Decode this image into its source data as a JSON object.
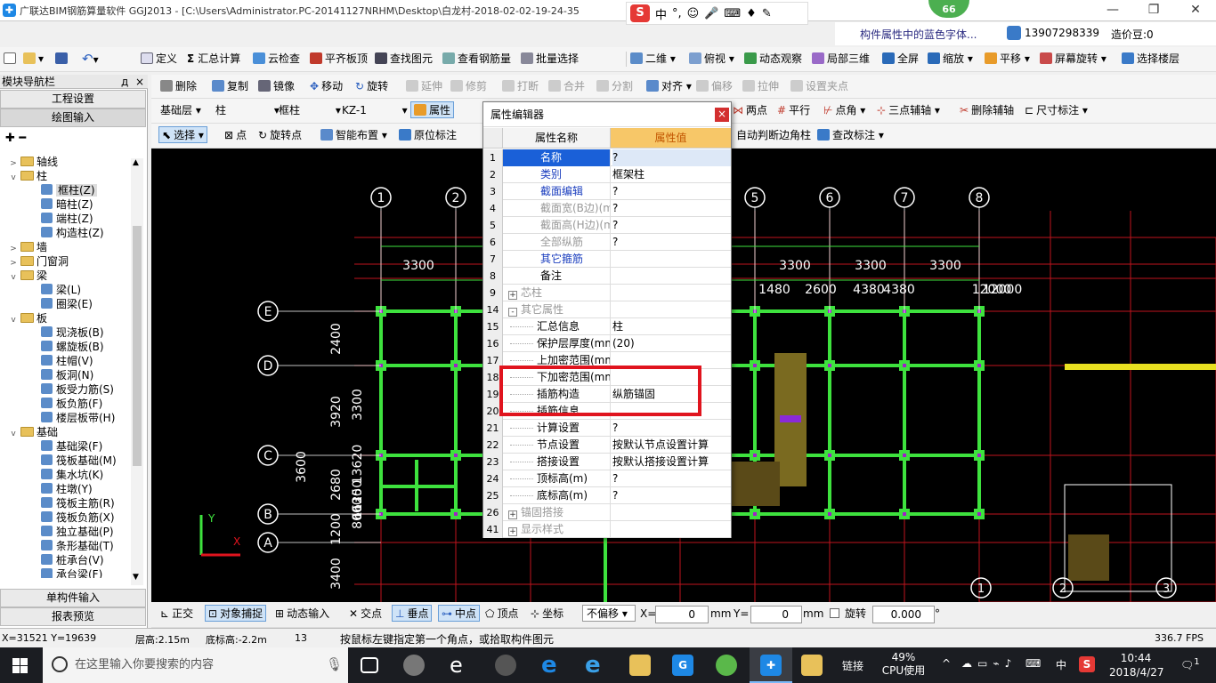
{
  "title_bar": {
    "title": "广联达BIM钢筋算量软件 GGJ2013 - [C:\\Users\\Administrator.PC-20141127NRHM\\Desktop\\白龙村-2018-02-02-19-24-35",
    "minimize": "—",
    "maximize": "❐",
    "close": "✕"
  },
  "ime": {
    "logo": "S",
    "lang": "中",
    "punct": "°,"
  },
  "badge": {
    "value": "66"
  },
  "info": {
    "hint": "构件属性中的蓝色字体...",
    "phone": "13907298339",
    "beans": "造价豆:0"
  },
  "toolbar1": {
    "items": [
      "定义",
      "汇总计算",
      "云检查",
      "平齐板顶",
      "查找图元",
      "查看钢筋量",
      "批量选择",
      "二维",
      "俯视",
      "动态观察",
      "局部三维",
      "全屏",
      "缩放",
      "平移",
      "屏幕旋转",
      "选择楼层"
    ]
  },
  "toolbar2": {
    "items": [
      "删除",
      "复制",
      "镜像",
      "移动",
      "旋转",
      "延伸",
      "修剪",
      "打断",
      "合并",
      "分割",
      "对齐",
      "偏移",
      "拉伸",
      "设置夹点"
    ]
  },
  "toolbar3": {
    "floor": "基础层",
    "type": "柱",
    "subtype": "框柱",
    "element": "KZ-1",
    "attr_btn": "属性",
    "right_items": [
      "两点",
      "平行",
      "点角",
      "三点辅轴",
      "删除辅轴",
      "尺寸标注"
    ]
  },
  "toolbar4": {
    "items": [
      "选择",
      "点",
      "旋转点",
      "智能布置",
      "原位标注"
    ],
    "right_items": [
      "自动判断边角柱",
      "查改标注"
    ]
  },
  "nav": {
    "header": "模块导航栏",
    "pin": "д",
    "close": "×",
    "top_buttons": [
      "工程设置",
      "绘图输入"
    ],
    "tree": [
      {
        "t": "轴线",
        "lvl": 0,
        "kind": "folder",
        "exp": ">"
      },
      {
        "t": "柱",
        "lvl": 0,
        "kind": "folder",
        "exp": "v"
      },
      {
        "t": "框柱(Z)",
        "lvl": 1,
        "kind": "leaf",
        "sel": true
      },
      {
        "t": "暗柱(Z)",
        "lvl": 1,
        "kind": "leaf"
      },
      {
        "t": "端柱(Z)",
        "lvl": 1,
        "kind": "leaf"
      },
      {
        "t": "构造柱(Z)",
        "lvl": 1,
        "kind": "leaf"
      },
      {
        "t": "墙",
        "lvl": 0,
        "kind": "folder",
        "exp": ">"
      },
      {
        "t": "门窗洞",
        "lvl": 0,
        "kind": "folder",
        "exp": ">"
      },
      {
        "t": "梁",
        "lvl": 0,
        "kind": "folder",
        "exp": "v"
      },
      {
        "t": "梁(L)",
        "lvl": 1,
        "kind": "leaf"
      },
      {
        "t": "圈梁(E)",
        "lvl": 1,
        "kind": "leaf"
      },
      {
        "t": "板",
        "lvl": 0,
        "kind": "folder",
        "exp": "v"
      },
      {
        "t": "现浇板(B)",
        "lvl": 1,
        "kind": "leaf"
      },
      {
        "t": "螺旋板(B)",
        "lvl": 1,
        "kind": "leaf"
      },
      {
        "t": "柱帽(V)",
        "lvl": 1,
        "kind": "leaf"
      },
      {
        "t": "板洞(N)",
        "lvl": 1,
        "kind": "leaf"
      },
      {
        "t": "板受力筋(S)",
        "lvl": 1,
        "kind": "leaf"
      },
      {
        "t": "板负筋(F)",
        "lvl": 1,
        "kind": "leaf"
      },
      {
        "t": "楼层板带(H)",
        "lvl": 1,
        "kind": "leaf"
      },
      {
        "t": "基础",
        "lvl": 0,
        "kind": "folder",
        "exp": "v"
      },
      {
        "t": "基础梁(F)",
        "lvl": 1,
        "kind": "leaf"
      },
      {
        "t": "筏板基础(M)",
        "lvl": 1,
        "kind": "leaf"
      },
      {
        "t": "集水坑(K)",
        "lvl": 1,
        "kind": "leaf"
      },
      {
        "t": "柱墩(Y)",
        "lvl": 1,
        "kind": "leaf"
      },
      {
        "t": "筏板主筋(R)",
        "lvl": 1,
        "kind": "leaf"
      },
      {
        "t": "筏板负筋(X)",
        "lvl": 1,
        "kind": "leaf"
      },
      {
        "t": "独立基础(P)",
        "lvl": 1,
        "kind": "leaf"
      },
      {
        "t": "条形基础(T)",
        "lvl": 1,
        "kind": "leaf"
      },
      {
        "t": "桩承台(V)",
        "lvl": 1,
        "kind": "leaf"
      },
      {
        "t": "承台梁(F)",
        "lvl": 1,
        "kind": "leaf"
      }
    ],
    "bottom_buttons": [
      "单构件输入",
      "报表预览"
    ]
  },
  "editor": {
    "title": "属性编辑器",
    "close": "×",
    "col_name": "属性名称",
    "col_value": "属性值",
    "rows": [
      {
        "n": "1",
        "k": "名称",
        "v": "?",
        "c": "blue",
        "sel": true
      },
      {
        "n": "2",
        "k": "类别",
        "v": "框架柱",
        "c": "blue"
      },
      {
        "n": "3",
        "k": "截面编辑",
        "v": "?",
        "c": "blue"
      },
      {
        "n": "4",
        "k": "截面宽(B边)(mm)",
        "v": "?",
        "c": "gray"
      },
      {
        "n": "5",
        "k": "截面高(H边)(mm)",
        "v": "?",
        "c": "gray"
      },
      {
        "n": "6",
        "k": "全部纵筋",
        "v": "?",
        "c": "gray"
      },
      {
        "n": "7",
        "k": "其它箍筋",
        "v": "",
        "c": "blue"
      },
      {
        "n": "8",
        "k": "备注",
        "v": "",
        "c": ""
      },
      {
        "n": "9",
        "k": "芯柱",
        "v": "",
        "c": "gray",
        "exp": "+"
      },
      {
        "n": "14",
        "k": "其它属性",
        "v": "",
        "c": "gray",
        "exp": "-"
      },
      {
        "n": "15",
        "k": "汇总信息",
        "v": "柱",
        "c": "",
        "ind": true
      },
      {
        "n": "16",
        "k": "保护层厚度(mm)",
        "v": "(20)",
        "c": "",
        "ind": true
      },
      {
        "n": "17",
        "k": "上加密范围(mm)",
        "v": "",
        "c": "",
        "ind": true
      },
      {
        "n": "18",
        "k": "下加密范围(mm)",
        "v": "",
        "c": "",
        "ind": true
      },
      {
        "n": "19",
        "k": "插筋构造",
        "v": "纵筋锚固",
        "c": "",
        "ind": true
      },
      {
        "n": "20",
        "k": "插筋信息",
        "v": "",
        "c": "",
        "ind": true
      },
      {
        "n": "21",
        "k": "计算设置",
        "v": "?",
        "c": "",
        "ind": true
      },
      {
        "n": "22",
        "k": "节点设置",
        "v": "按默认节点设置计算",
        "c": "",
        "ind": true
      },
      {
        "n": "23",
        "k": "搭接设置",
        "v": "按默认搭接设置计算",
        "c": "",
        "ind": true
      },
      {
        "n": "24",
        "k": "顶标高(m)",
        "v": "?",
        "c": "",
        "ind": true
      },
      {
        "n": "25",
        "k": "底标高(m)",
        "v": "?",
        "c": "",
        "ind": true
      },
      {
        "n": "26",
        "k": "锚固搭接",
        "v": "",
        "c": "gray",
        "exp": "+"
      },
      {
        "n": "41",
        "k": "显示样式",
        "v": "",
        "c": "gray",
        "exp": "+"
      }
    ]
  },
  "drawing": {
    "axis_top": [
      "1",
      "2",
      "5",
      "6",
      "7",
      "8"
    ],
    "axis_left": [
      "E",
      "D",
      "C",
      "B",
      "A"
    ],
    "dims_top": [
      "3300",
      "3300",
      "3300",
      "3300",
      "1480",
      "2600",
      "4380",
      "4380",
      "12000",
      "12000"
    ],
    "dims_left": [
      "2400",
      "3920",
      "3300",
      "3600",
      "2680",
      "1200",
      "3400",
      "13620",
      "11250",
      "8000",
      "6630"
    ],
    "axis_bottom": [
      "1",
      "2",
      "3"
    ],
    "ucs_x": "X",
    "ucs_y": "Y"
  },
  "snapbar": {
    "items": [
      "正交",
      "对象捕捉",
      "动态输入",
      "交点",
      "垂点",
      "中点",
      "顶点",
      "坐标"
    ],
    "offset": "不偏移",
    "x_label": "X=",
    "x_value": "0",
    "mm1": "mm",
    "y_label": "Y=",
    "y_value": "0",
    "mm2": "mm",
    "rotate": "旋转",
    "rot_value": "0.000",
    "deg": "°"
  },
  "statusbar": {
    "coords": "X=31521 Y=19639",
    "floor_h": "层高:2.15m",
    "bottom_h": "底标高:-2.2m",
    "num": "13",
    "hint": "按鼠标左键指定第一个角点，或拾取构件图元",
    "fps": "336.7 FPS"
  },
  "taskbar": {
    "search": "在这里输入你要搜索的内容",
    "link": "链接",
    "cpu": "49%",
    "cpu_label": "CPU使用",
    "lang": "中",
    "time": "10:44",
    "date": "2018/4/27",
    "notif": "1"
  },
  "colors": {
    "accent": "#1a60d8",
    "highlight": "#e0141e",
    "grid_green": "#3ee23e",
    "header_orange": "#f7c768"
  }
}
